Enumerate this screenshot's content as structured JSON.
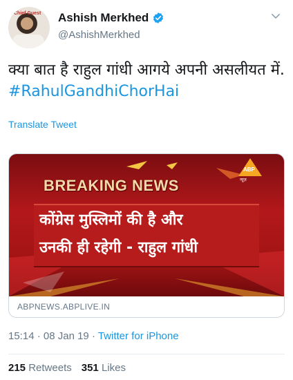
{
  "tweet": {
    "author": {
      "display_name": "Ashish Merkhed",
      "handle": "@AshishMerkhed",
      "verified": true,
      "avatar_caption": "Chief Guest"
    },
    "text_main": "क्या बात है राहुल गांधी आगये अपनी असलीयत में. ",
    "hashtag": "#RahulGandhiChorHai",
    "translate_label": "Translate Tweet",
    "card": {
      "breaking_label": "BREAKING NEWS",
      "logo_text": "ABP",
      "logo_sub": "न्यूज़",
      "headline_line1": "कोंग्रेस मुस्लिमों की है और",
      "headline_line2": "उनकी ही रहेगी - राहुल गांधी",
      "domain": "ABPNEWS.ABPLIVE.IN"
    },
    "time": "15:14",
    "date": "08 Jan 19",
    "source": "Twitter for iPhone",
    "separator": " · ",
    "retweets_count": "215",
    "retweets_label": "Retweets",
    "likes_count": "351",
    "likes_label": "Likes"
  },
  "colors": {
    "link": "#1b95e0",
    "muted": "#657786",
    "card_red": "#b71c1c",
    "verified_badge": "#1da1f2"
  }
}
